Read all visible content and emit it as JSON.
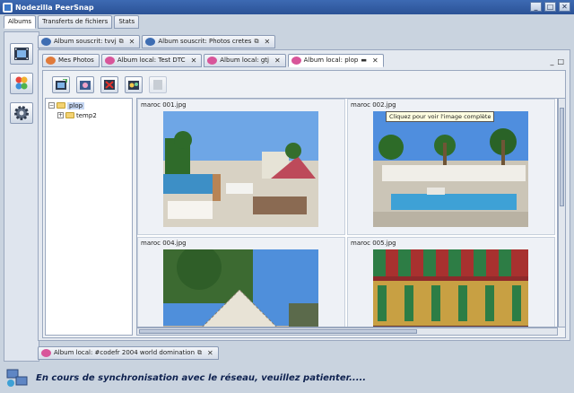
{
  "window": {
    "title": "Nodezilla PeerSnap",
    "min": "_",
    "max": "□",
    "close": "✕"
  },
  "main_tabs": [
    "Albums",
    "Transferts de fichiers",
    "Stats"
  ],
  "top_tabs": [
    {
      "label": "Album souscrit: tvvj"
    },
    {
      "label": "Album souscrit: Photos cretes"
    }
  ],
  "album_tabs": [
    {
      "label": "Mes Photos"
    },
    {
      "label": "Album local: Test DTC"
    },
    {
      "label": "Album local: gtj"
    },
    {
      "label": "Album local: plop"
    }
  ],
  "tree": {
    "root": {
      "label": "plop",
      "expander": "−"
    },
    "child": {
      "label": "temp2",
      "expander": "+"
    }
  },
  "thumbnails": [
    "maroc 001.jpg",
    "maroc 002.jpg",
    "maroc 004.jpg",
    "maroc 005.jpg"
  ],
  "tooltip": "Cliquez pour voir l'image complète",
  "panel_controls": {
    "minimize": "_",
    "maximize": "□"
  },
  "bottom_tab": {
    "label": "Album local: #codefr 2004 world domination"
  },
  "status": {
    "message": "En cours de synchronisation avec le réseau, veuillez patienter....."
  }
}
